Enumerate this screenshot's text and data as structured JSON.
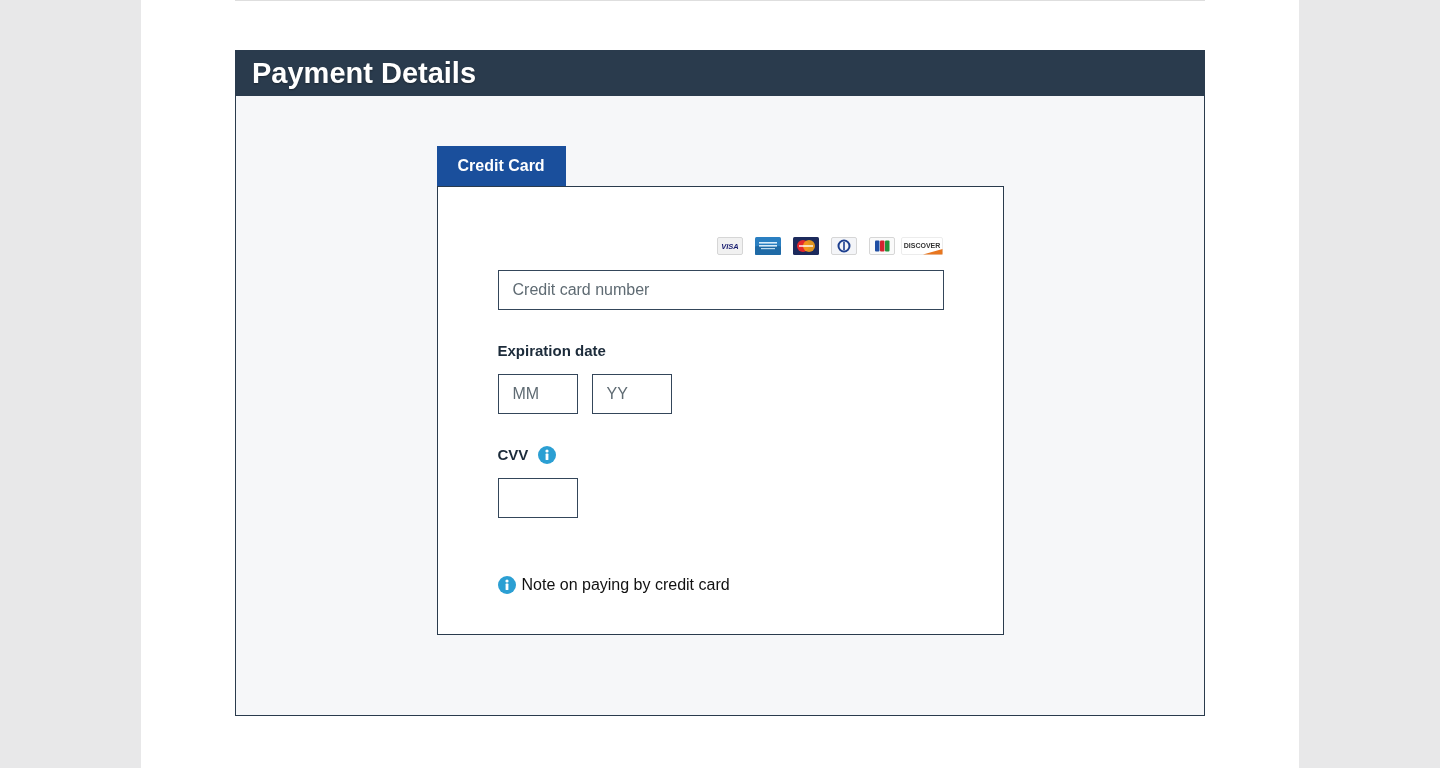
{
  "section": {
    "title": "Payment Details"
  },
  "tabs": [
    {
      "label": "Credit Card",
      "selected": true
    }
  ],
  "card_logos": [
    {
      "kind": "visa",
      "text": "VISA"
    },
    {
      "kind": "amex"
    },
    {
      "kind": "mastercard"
    },
    {
      "kind": "diners"
    },
    {
      "kind": "jcb"
    },
    {
      "kind": "discover",
      "text": "DISCOVER"
    }
  ],
  "card_number": {
    "placeholder": "Credit card number"
  },
  "expiration": {
    "label": "Expiration date",
    "fields": [
      {
        "placeholder": "MM"
      },
      {
        "placeholder": "YY"
      }
    ]
  },
  "cvv": {
    "label": "CVV"
  },
  "note": {
    "text": "Note on paying by credit card"
  }
}
